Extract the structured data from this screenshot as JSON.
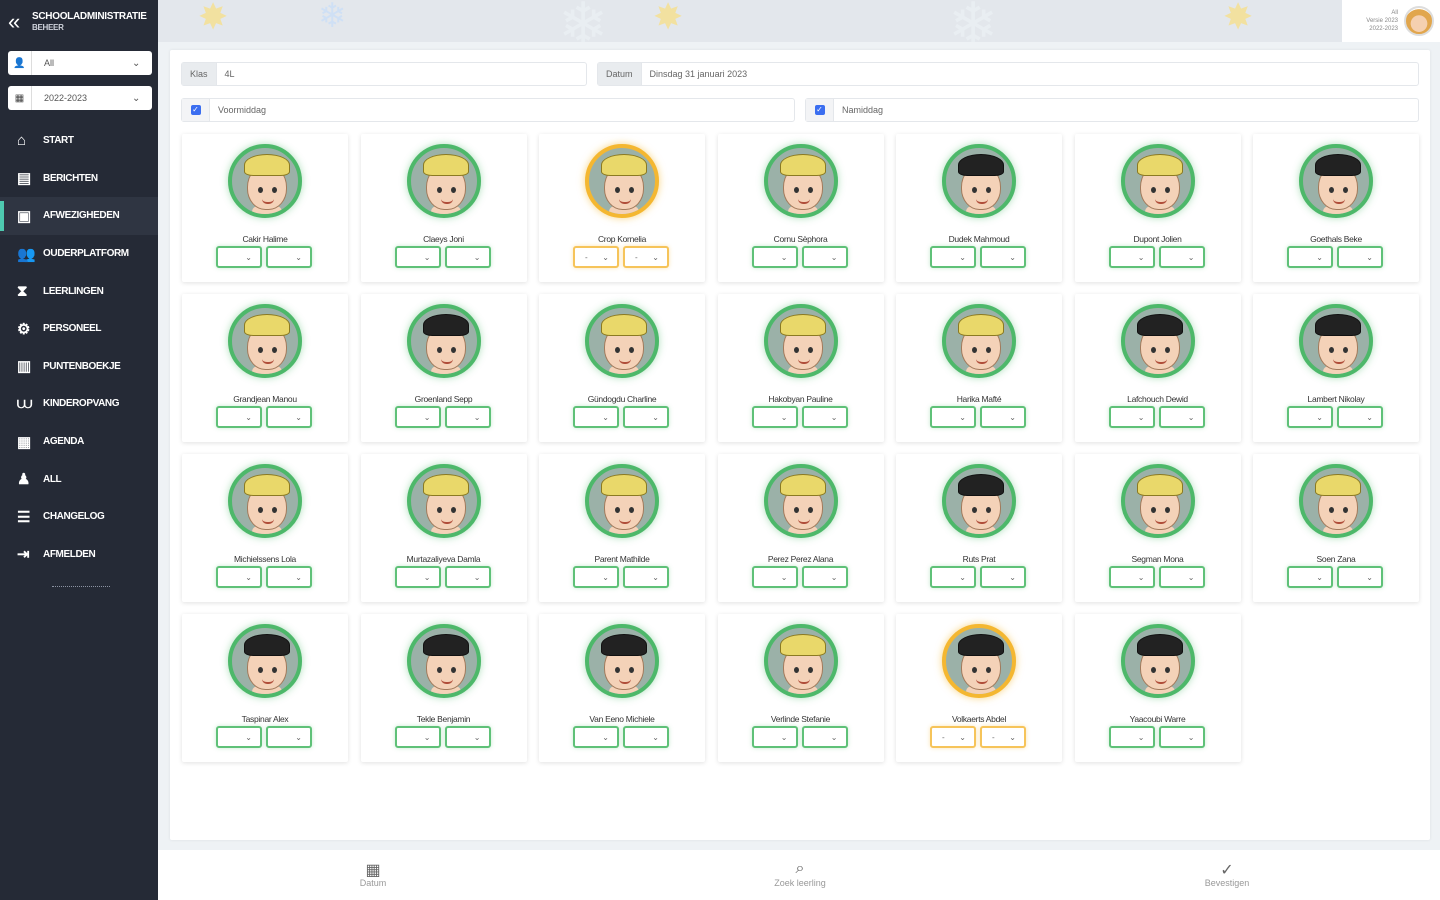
{
  "sidebar": {
    "brand_line1": "SCHOOLADMINISTRATIE",
    "brand_line2": "BEHEER",
    "select_user": "All",
    "select_year": "2022-2023",
    "items": [
      {
        "label": "START",
        "icon": "home-icon"
      },
      {
        "label": "BERICHTEN",
        "icon": "inbox-icon"
      },
      {
        "label": "AFWEZIGHEDEN",
        "icon": "briefcase-medical-icon"
      },
      {
        "label": "OUDERPLATFORM",
        "icon": "users-icon"
      },
      {
        "label": "LEERLINGEN",
        "icon": "hourglass-icon"
      },
      {
        "label": "PERSONEEL",
        "icon": "users-cog-icon"
      },
      {
        "label": "PUNTENBOEKJE",
        "icon": "book-open-icon"
      },
      {
        "label": "KINDEROPVANG",
        "icon": "children-icon"
      },
      {
        "label": "AGENDA",
        "icon": "calendar-icon"
      },
      {
        "label": "All",
        "icon": "user-settings-icon"
      },
      {
        "label": "CHANGELOG",
        "icon": "list-icon"
      },
      {
        "label": "AFMELDEN",
        "icon": "sign-out-icon"
      }
    ]
  },
  "user": {
    "line1": "All",
    "line2": "Versie 2023",
    "line3": "2022-2023"
  },
  "filters": {
    "klas_label": "Klas",
    "klas_value": "4L",
    "datum_label": "Datum",
    "datum_value": "Dinsdag 31 januari 2023",
    "voormiddag": "Voormiddag",
    "namiddag": "Namiddag"
  },
  "students": [
    {
      "name": "Cakir Halime",
      "hair": "blond",
      "status": "green"
    },
    {
      "name": "Claeys Joni",
      "hair": "blond",
      "status": "green"
    },
    {
      "name": "Crop Kornelia",
      "hair": "blond",
      "status": "orange"
    },
    {
      "name": "Cornu Sèphora",
      "hair": "blond",
      "status": "green"
    },
    {
      "name": "Dudek Mahmoud",
      "hair": "dark",
      "status": "green"
    },
    {
      "name": "Dupont Jolien",
      "hair": "blond",
      "status": "green"
    },
    {
      "name": "Goethals Beke",
      "hair": "dark",
      "status": "green"
    },
    {
      "name": "Grandjean Manou",
      "hair": "blond",
      "status": "green"
    },
    {
      "name": "Groenland Sepp",
      "hair": "dark",
      "status": "green"
    },
    {
      "name": "Gündogdu Charline",
      "hair": "blond",
      "status": "green"
    },
    {
      "name": "Hakobyan Pauline",
      "hair": "blond",
      "status": "green"
    },
    {
      "name": "Harika Mafté",
      "hair": "blond",
      "status": "green"
    },
    {
      "name": "Lafchouch Dewid",
      "hair": "dark",
      "status": "green"
    },
    {
      "name": "Lambert Nikolay",
      "hair": "dark",
      "status": "green"
    },
    {
      "name": "Michielssens Lola",
      "hair": "blond",
      "status": "green"
    },
    {
      "name": "Murtazaliyeva Damla",
      "hair": "blond",
      "status": "green"
    },
    {
      "name": "Parent Mathilde",
      "hair": "blond",
      "status": "green"
    },
    {
      "name": "Perez Perez Alana",
      "hair": "blond",
      "status": "green"
    },
    {
      "name": "Ruts Prat",
      "hair": "dark",
      "status": "green"
    },
    {
      "name": "Segman Mona",
      "hair": "blond",
      "status": "green"
    },
    {
      "name": "Soen Zana",
      "hair": "blond",
      "status": "green"
    },
    {
      "name": "Taspinar Alex",
      "hair": "dark",
      "status": "green"
    },
    {
      "name": "Tekle Benjamin",
      "hair": "dark",
      "status": "green"
    },
    {
      "name": "Van Eeno Michiele",
      "hair": "dark",
      "status": "green"
    },
    {
      "name": "Verlinde Stefanie",
      "hair": "blond",
      "status": "green"
    },
    {
      "name": "Volkaerts Abdel",
      "hair": "dark",
      "status": "orange"
    },
    {
      "name": "Yaacoubi Warre",
      "hair": "dark",
      "status": "green"
    }
  ],
  "dropdown_value_orange": "-",
  "bottom": {
    "datum": "Datum",
    "zoek": "Zoek leerling",
    "bevestigen": "Bevestigen"
  },
  "colors": {
    "sidebar": "#252a36",
    "green": "#4db86a",
    "orange": "#f4b731",
    "accent": "#4ec9b0"
  }
}
